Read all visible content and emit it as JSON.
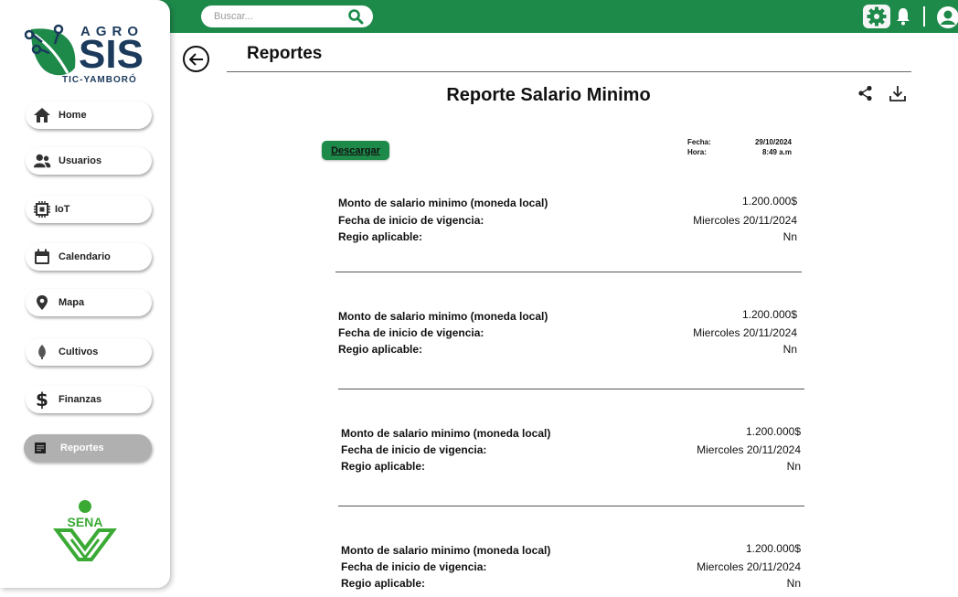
{
  "app": {
    "brand_top": "AGRO",
    "brand_main": "SIS",
    "brand_sub": "TIC-YAMBORÓ",
    "sena_label": "SENA"
  },
  "topbar": {
    "search_placeholder": "Buscar...",
    "accent": "#1e8a4a"
  },
  "sidebar": {
    "items": [
      {
        "label": "Home",
        "icon": "home-icon"
      },
      {
        "label": "Usuarios",
        "icon": "users-icon"
      },
      {
        "label": "IoT",
        "icon": "chip-icon"
      },
      {
        "label": "Calendario",
        "icon": "calendar-icon"
      },
      {
        "label": "Mapa",
        "icon": "map-pin-icon"
      },
      {
        "label": "Cultivos",
        "icon": "leaf-icon"
      },
      {
        "label": "Finanzas",
        "icon": "dollar-icon"
      },
      {
        "label": "Reportes",
        "icon": "report-icon",
        "active": true
      }
    ]
  },
  "main": {
    "page_title": "Reportes",
    "report_title": "Reporte Salario Minimo",
    "download_button": "Descargar",
    "date_label": "Fecha:",
    "date_value": "29/10/2024",
    "time_label": "Hora:",
    "time_value": "8:49 a.m"
  },
  "records": [
    {
      "label1": "Monto de salario minimo (moneda local)",
      "value1": "1.200.000$",
      "label2": "Fecha de inicio de vigencia:",
      "value2": "Miercoles 20/11/2024",
      "label3": "Regio aplicable:",
      "value3": "Nn"
    },
    {
      "label1": "Monto de salario minimo (moneda local)",
      "value1": "1.200.000$",
      "label2": "Fecha de inicio de vigencia:",
      "value2": "Miercoles 20/11/2024",
      "label3": "Regio aplicable:",
      "value3": "Nn"
    },
    {
      "label1": "Monto de salario minimo (moneda local)",
      "value1": "1.200.000$",
      "label2": "Fecha de inicio de vigencia:",
      "value2": "Miercoles 20/11/2024",
      "label3": "Regio aplicable:",
      "value3": "Nn"
    },
    {
      "label1": "Monto de salario minimo (moneda local)",
      "value1": "1.200.000$",
      "label2": "Fecha de inicio de vigencia:",
      "value2": "Miercoles 20/11/2024",
      "label3": "Regio aplicable:",
      "value3": "Nn"
    }
  ]
}
